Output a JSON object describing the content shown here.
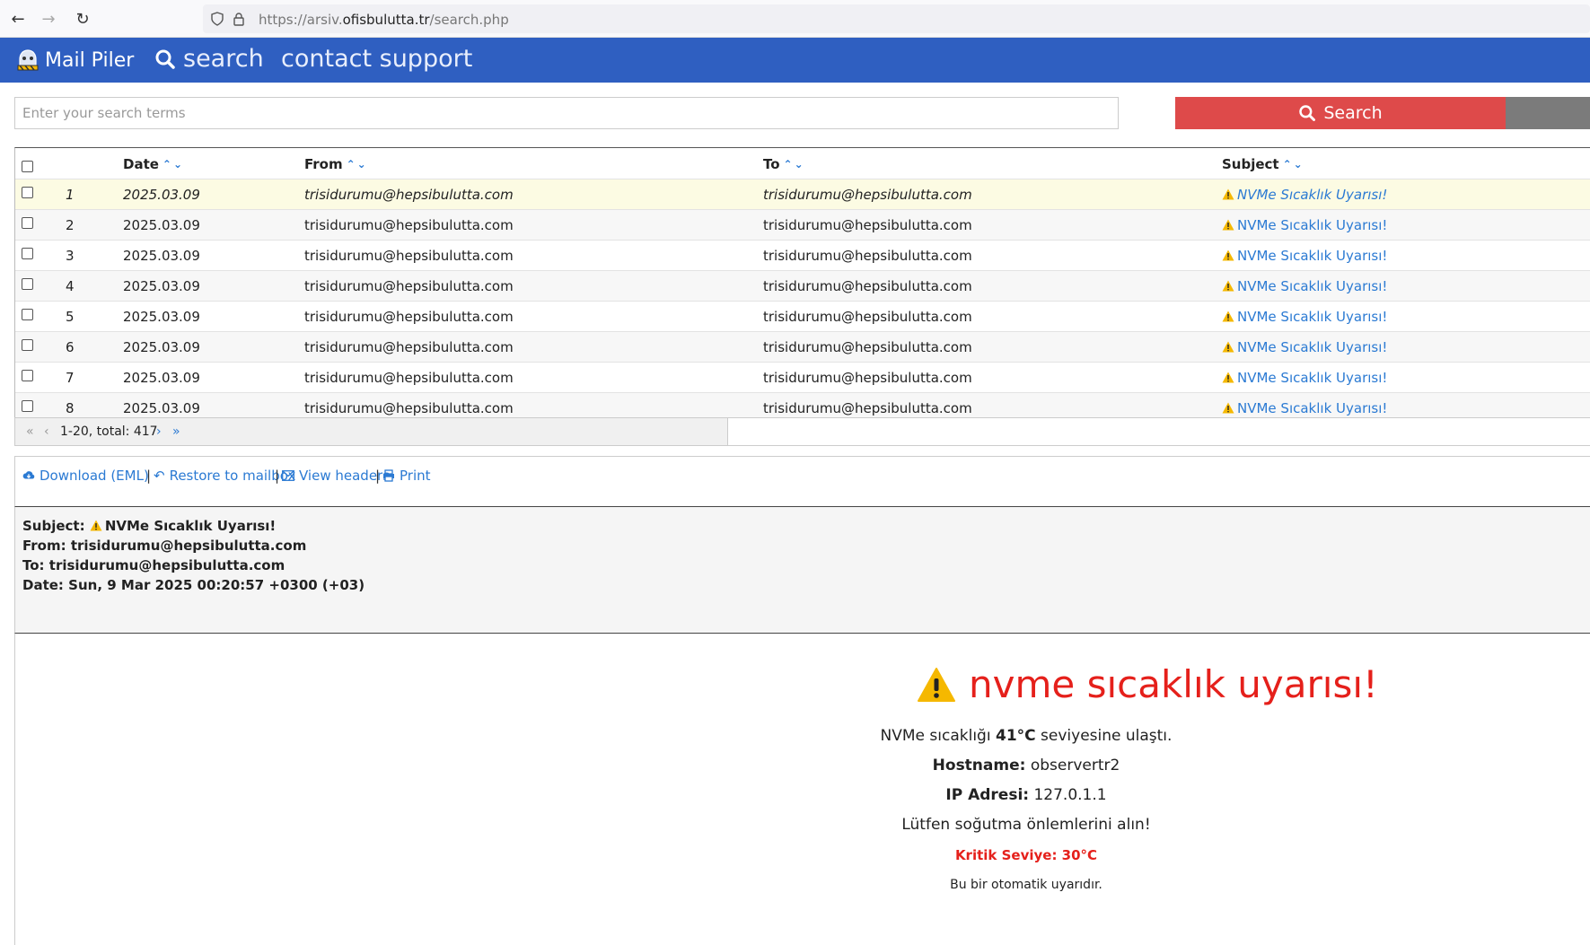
{
  "browser": {
    "url_prefix": "https://arsiv.",
    "url_domain": "ofisbulutta.tr",
    "url_path": "/search.php"
  },
  "app": {
    "brand": "Mail Piler",
    "menu": [
      "search",
      "contact support"
    ]
  },
  "search": {
    "placeholder": "Enter your search terms",
    "button_label": "Search"
  },
  "table": {
    "headers": {
      "date": "Date",
      "from": "From",
      "to": "To",
      "subject": "Subject"
    },
    "rows": [
      {
        "num": "1",
        "date": "2025.03.09",
        "from": "trisidurumu@hepsibulutta.com",
        "to": "trisidurumu@hepsibulutta.com",
        "subject": "NVMe Sıcaklık Uyarısı!"
      },
      {
        "num": "2",
        "date": "2025.03.09",
        "from": "trisidurumu@hepsibulutta.com",
        "to": "trisidurumu@hepsibulutta.com",
        "subject": "NVMe Sıcaklık Uyarısı!"
      },
      {
        "num": "3",
        "date": "2025.03.09",
        "from": "trisidurumu@hepsibulutta.com",
        "to": "trisidurumu@hepsibulutta.com",
        "subject": "NVMe Sıcaklık Uyarısı!"
      },
      {
        "num": "4",
        "date": "2025.03.09",
        "from": "trisidurumu@hepsibulutta.com",
        "to": "trisidurumu@hepsibulutta.com",
        "subject": "NVMe Sıcaklık Uyarısı!"
      },
      {
        "num": "5",
        "date": "2025.03.09",
        "from": "trisidurumu@hepsibulutta.com",
        "to": "trisidurumu@hepsibulutta.com",
        "subject": "NVMe Sıcaklık Uyarısı!"
      },
      {
        "num": "6",
        "date": "2025.03.09",
        "from": "trisidurumu@hepsibulutta.com",
        "to": "trisidurumu@hepsibulutta.com",
        "subject": "NVMe Sıcaklık Uyarısı!"
      },
      {
        "num": "7",
        "date": "2025.03.09",
        "from": "trisidurumu@hepsibulutta.com",
        "to": "trisidurumu@hepsibulutta.com",
        "subject": "NVMe Sıcaklık Uyarısı!"
      },
      {
        "num": "8",
        "date": "2025.03.09",
        "from": "trisidurumu@hepsibulutta.com",
        "to": "trisidurumu@hepsibulutta.com",
        "subject": "NVMe Sıcaklık Uyarısı!"
      }
    ],
    "selected_row": 1,
    "pager_text": "1-20, total: 417"
  },
  "actions": {
    "download": "Download (EML)",
    "restore": "Restore to mailbox",
    "view_headers": "View headers",
    "print": "Print",
    "separator": "|"
  },
  "message": {
    "subject_label": "Subject:",
    "subject": "NVMe Sıcaklık Uyarısı!",
    "from_label": "From:",
    "from": "trisidurumu@hepsibulutta.com",
    "to_label": "To:",
    "to": "trisidurumu@hepsibulutta.com",
    "date_label": "Date:",
    "date": "Sun, 9 Mar 2025 00:20:57 +0300 (+03)"
  },
  "email_body": {
    "title": "nvme sıcaklık uyarısı!",
    "temp_prefix": "NVMe sıcaklığı",
    "temp_value": "41°C",
    "temp_suffix": "seviyesine ulaştı.",
    "hostname_label": "Hostname:",
    "hostname": "observertr2",
    "ip_label": "IP Adresi:",
    "ip": "127.0.1.1",
    "advice": "Lütfen soğutma önlemlerini alın!",
    "critical": "Kritik Seviye: 30°C",
    "automatic": "Bu bir otomatik uyarıdır."
  },
  "colors": {
    "appbar": "#2f5fc1",
    "search_button": "#de4a4a",
    "link": "#2b7ad3",
    "alert_red": "#e5201b",
    "warning_yellow": "#f5b800"
  }
}
